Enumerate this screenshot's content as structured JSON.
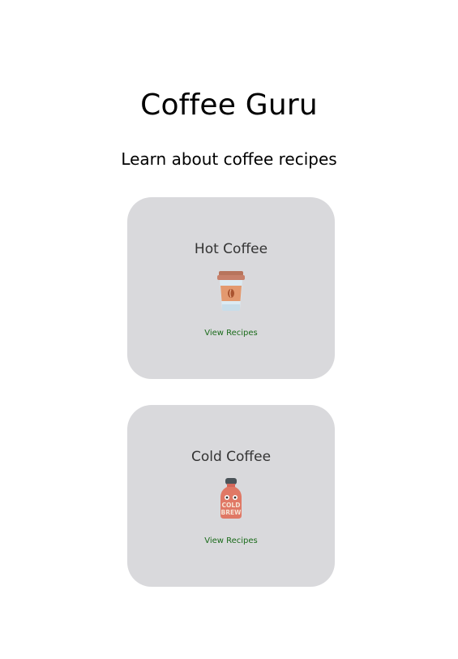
{
  "header": {
    "title": "Coffee Guru",
    "subtitle": "Learn about coffee recipes"
  },
  "cards": [
    {
      "title": "Hot Coffee",
      "icon": "hot-coffee-cup-icon",
      "link_label": "View Recipes"
    },
    {
      "title": "Cold Coffee",
      "icon": "cold-brew-bottle-icon",
      "icon_text": [
        "COLD",
        "BREW"
      ],
      "link_label": "View Recipes"
    }
  ],
  "colors": {
    "card_bg": "#d9d9dc",
    "link": "#1a6b1a"
  }
}
